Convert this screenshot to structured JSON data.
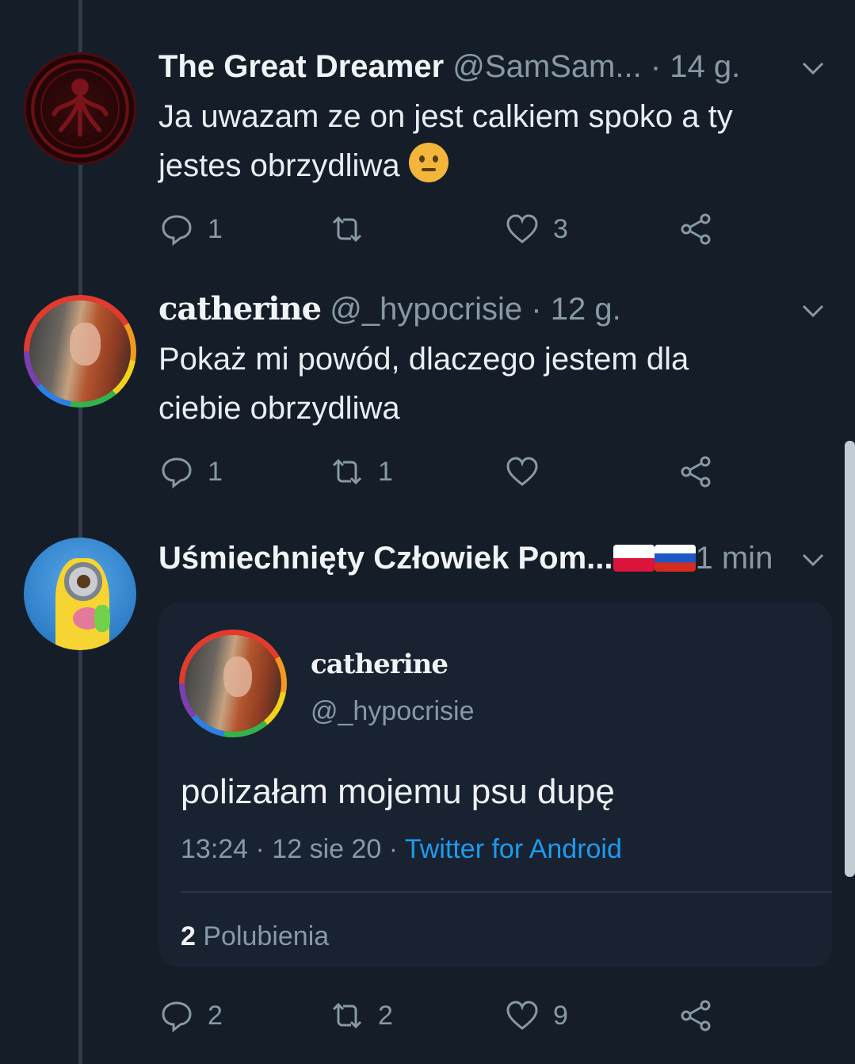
{
  "tweets": [
    {
      "display_name": "The Great Dreamer",
      "handle": "@SamSam...",
      "time": "· 14 g.",
      "text": "Ja uwazam ze on jest calkiem spoko a ty jestes obrzydliwa",
      "emoji": "thinking-face",
      "replies": "1",
      "retweets": "",
      "likes": "3"
    },
    {
      "display_name": "catherine",
      "handle": "@_hypocrisie",
      "time": "· 12 g.",
      "text_line1": "Pokaż mi powód, dlaczego jestem dla",
      "text_line2": "ciebie obrzydliwa",
      "replies": "1",
      "retweets": "1",
      "likes": ""
    },
    {
      "display_name": "Uśmiechnięty Człowiek Pom...",
      "flags": [
        "flag-poland",
        "flag-russia"
      ],
      "time": "1 min",
      "replies": "2",
      "retweets": "2",
      "likes": "9",
      "quoted": {
        "display_name": "catherine",
        "handle": "@_hypocrisie",
        "text": "polizałam mojemu psu dupę",
        "timestamp": "13:24 · 12 sie 20 · ",
        "source": "Twitter for Android",
        "likes_count": "2",
        "likes_label": "Polubienia"
      }
    }
  ],
  "icons": [
    "reply-icon",
    "retweet-icon",
    "like-icon",
    "share-icon",
    "chevron-down-icon"
  ],
  "colors": {
    "background": "#151d28",
    "muted": "#8899a6",
    "link": "#1d9bf0",
    "thread_line": "#2e3c4c"
  }
}
